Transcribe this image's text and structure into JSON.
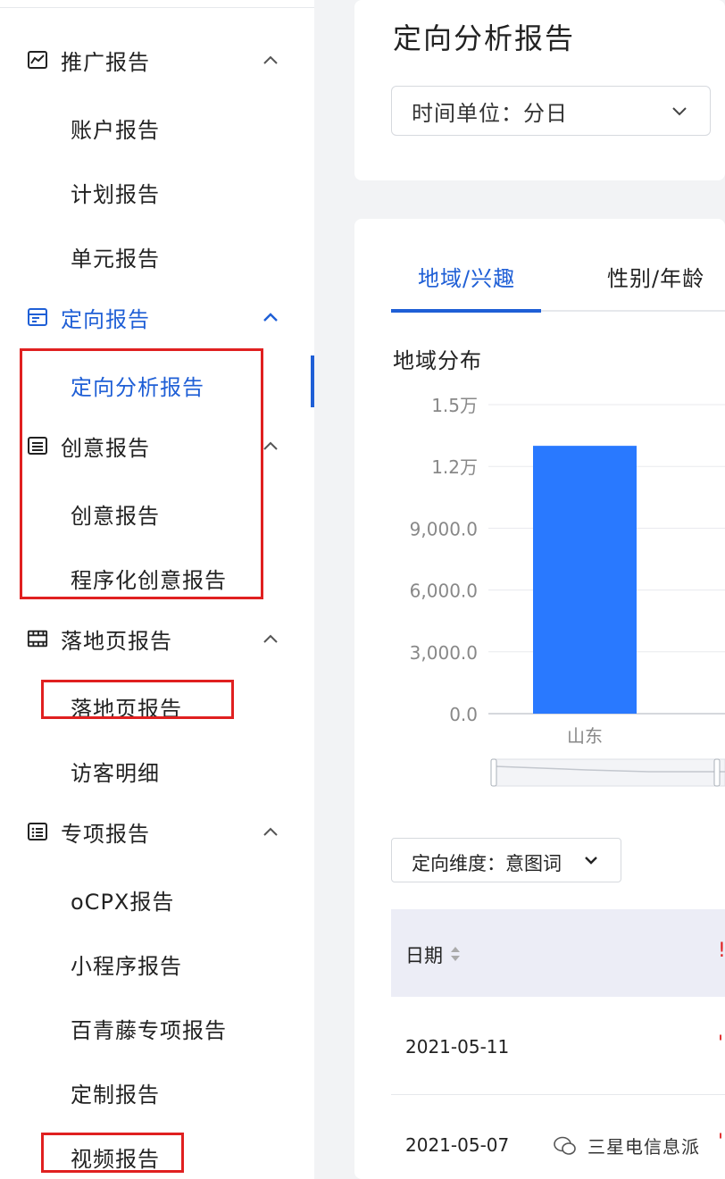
{
  "sidebar": {
    "groups": [
      {
        "label": "推广报告",
        "icon": "chart-report-icon",
        "items": [
          "账户报告",
          "计划报告",
          "单元报告"
        ]
      },
      {
        "label": "定向报告",
        "icon": "targeting-report-icon",
        "items": [
          "定向分析报告"
        ],
        "active_item": "定向分析报告"
      },
      {
        "label": "创意报告",
        "icon": "creative-report-icon",
        "items": [
          "创意报告",
          "程序化创意报告"
        ]
      },
      {
        "label": "落地页报告",
        "icon": "landing-page-icon",
        "items": [
          "落地页报告",
          "访客明细"
        ]
      },
      {
        "label": "专项报告",
        "icon": "special-report-icon",
        "items": [
          "oCPX报告",
          "小程序报告",
          "百青藤专项报告",
          "定制报告",
          "视频报告"
        ]
      }
    ]
  },
  "header": {
    "title": "定向分析报告",
    "time_unit_select": "时间单位：分日"
  },
  "tabs": [
    "地域/兴趣",
    "性别/年龄"
  ],
  "active_tab": "地域/兴趣",
  "chart_section": {
    "title": "地域分布"
  },
  "chart_data": {
    "type": "bar",
    "title": "地域分布",
    "categories": [
      "山东"
    ],
    "values": [
      13000
    ],
    "ylim": [
      0,
      15000
    ],
    "yticks": [
      "0.0",
      "3,000.0",
      "6,000.0",
      "9,000.0",
      "1.2万",
      "1.5万"
    ],
    "ytick_values": [
      0,
      3000,
      6000,
      9000,
      12000,
      15000
    ],
    "grid": true,
    "bar_color": "#2979ff"
  },
  "table": {
    "dimension_select": "定向维度：意图词",
    "header_date": "日期",
    "rows": [
      {
        "date": "2021-05-11"
      },
      {
        "date": "2021-05-07"
      }
    ]
  },
  "watermark": "三星电信息派",
  "colors": {
    "accent": "#1f5fd6",
    "annotation_red": "#e02020",
    "bar": "#2979ff"
  }
}
